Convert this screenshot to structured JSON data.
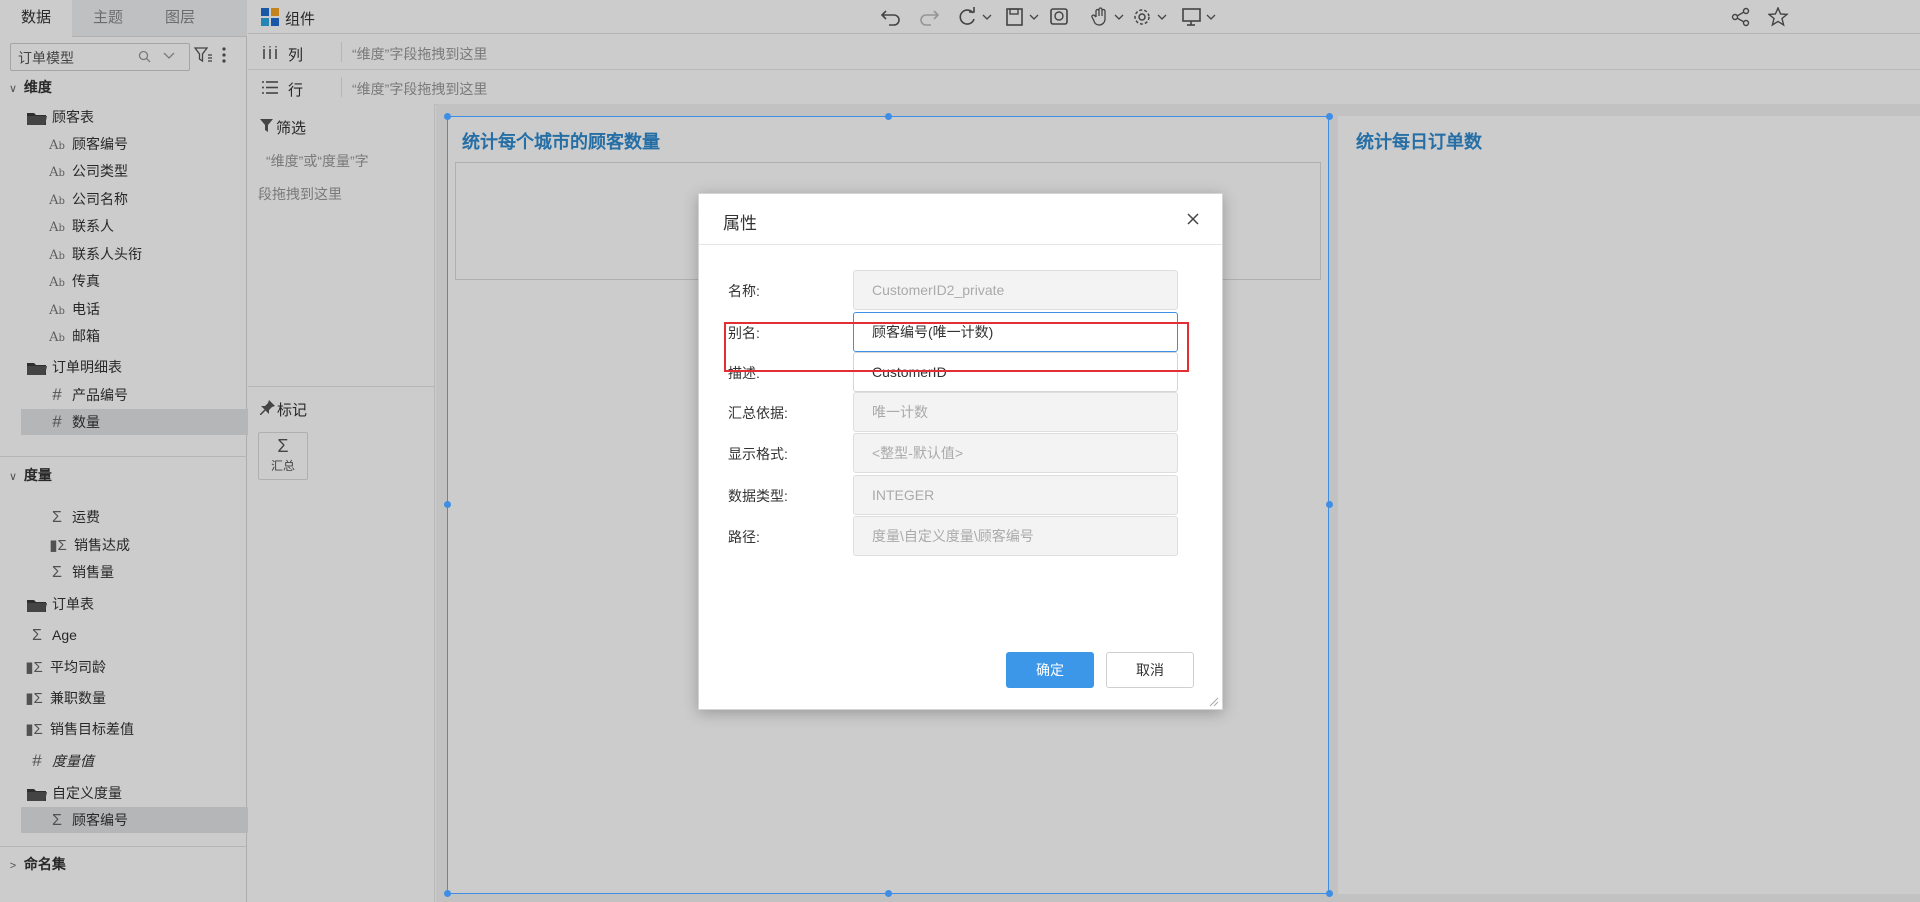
{
  "left_panel": {
    "tabs": [
      "数据",
      "主题",
      "图层"
    ],
    "model_select": "订单模型",
    "sections": {
      "dimension": "维度",
      "measure": "度量",
      "named_set": "命名集"
    },
    "dimension_items": [
      {
        "type": "folder",
        "label": "顾客表"
      },
      {
        "type": "text",
        "label": "顾客编号"
      },
      {
        "type": "text",
        "label": "公司类型"
      },
      {
        "type": "text",
        "label": "公司名称"
      },
      {
        "type": "text",
        "label": "联系人"
      },
      {
        "type": "text",
        "label": "联系人头衔"
      },
      {
        "type": "text",
        "label": "传真"
      },
      {
        "type": "text",
        "label": "电话"
      },
      {
        "type": "text",
        "label": "邮箱"
      },
      {
        "type": "folder",
        "label": "订单明细表"
      },
      {
        "type": "number",
        "label": "产品编号"
      },
      {
        "type": "number",
        "label": "数量"
      }
    ],
    "measure_items": [
      {
        "type": "sigma",
        "label": "运费"
      },
      {
        "type": "calc",
        "label": "销售达成"
      },
      {
        "type": "sigma",
        "label": "销售量"
      },
      {
        "type": "folder",
        "label": "订单表"
      },
      {
        "type": "sigma",
        "label": "Age"
      },
      {
        "type": "calc",
        "label": "平均司龄"
      },
      {
        "type": "calc",
        "label": "兼职数量"
      },
      {
        "type": "calc",
        "label": "销售目标差值"
      },
      {
        "type": "number",
        "label": "度量值"
      },
      {
        "type": "folder",
        "label": "自定义度量"
      },
      {
        "type": "sigma",
        "label": "顾客编号"
      }
    ]
  },
  "toolbar": {
    "components_label": "组件"
  },
  "shelves": {
    "columns_label": "列",
    "rows_label": "行",
    "hint": "“维度”字段拖拽到这里"
  },
  "filter_panel": {
    "filter_label": "筛选",
    "filter_hint_line1": "“维度”或“度量”字",
    "filter_hint_line2": "段拖拽到这里",
    "mark_label": "标记",
    "summary_label": "汇总"
  },
  "widgets": {
    "left_title": "统计每个城市的顾客数量",
    "right_title": "统计每日订单数"
  },
  "dialog": {
    "title": "属性",
    "fields": [
      {
        "label": "名称:",
        "value": "CustomerID2_private",
        "state": "disabled"
      },
      {
        "label": "别名:",
        "value": "顾客编号(唯一计数)",
        "state": "focused"
      },
      {
        "label": "描述:",
        "value": "CustomerID",
        "state": "editable"
      },
      {
        "label": "汇总依据:",
        "value": "唯一计数",
        "state": "disabled"
      },
      {
        "label": "显示格式:",
        "value": "<整型-默认值>",
        "state": "disabled"
      },
      {
        "label": "数据类型:",
        "value": "INTEGER",
        "state": "disabled"
      },
      {
        "label": "路径:",
        "value": "度量\\自定义度量\\顾客编号",
        "state": "disabled"
      }
    ],
    "ok_label": "确定",
    "cancel_label": "取消"
  },
  "colors": {
    "accent": "#3c97e8",
    "title_blue": "#2f8bd0",
    "highlight": "#e52e34",
    "selection_border": "#3f8ee6"
  }
}
